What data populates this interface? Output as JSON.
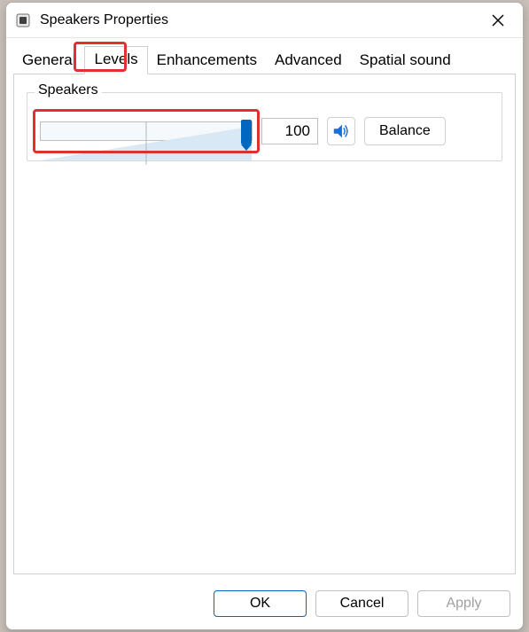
{
  "window": {
    "title": "Speakers Properties"
  },
  "tabs": {
    "items": [
      {
        "label": "General"
      },
      {
        "label": "Levels"
      },
      {
        "label": "Enhancements"
      },
      {
        "label": "Advanced"
      },
      {
        "label": "Spatial sound"
      }
    ],
    "active_index": 1
  },
  "group": {
    "label": "Speakers",
    "slider_value": 100,
    "value_text": "100",
    "balance_label": "Balance"
  },
  "buttons": {
    "ok": "OK",
    "cancel": "Cancel",
    "apply": "Apply"
  },
  "highlights": {
    "tab_levels": true,
    "slider": true
  },
  "colors": {
    "accent": "#0067c0",
    "highlight_border": "#e03030"
  }
}
